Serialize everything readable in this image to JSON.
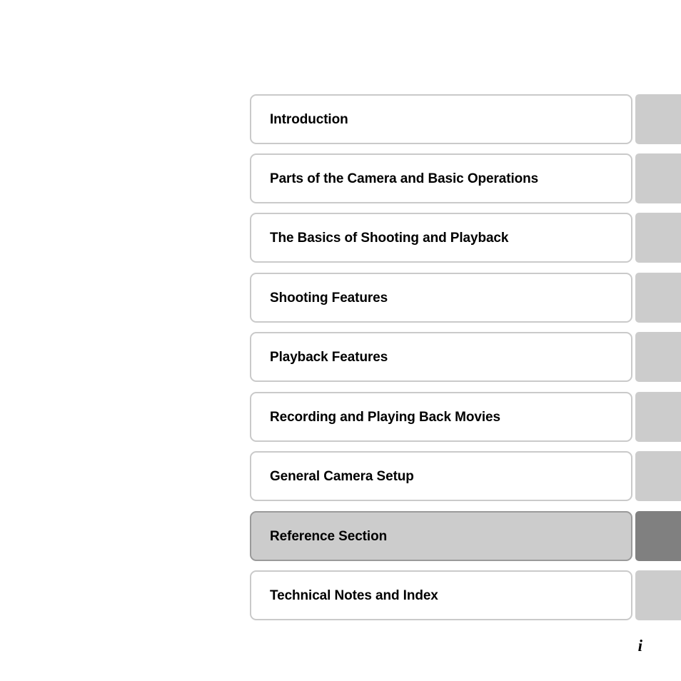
{
  "page": {
    "kind": "camera-manual-section-index",
    "background_color": "#ffffff",
    "page_number": "i"
  },
  "theme": {
    "plate_fill": "#ffffff",
    "plate_border": "#cacaca",
    "tab_fill": "#cccccc",
    "current_plate_fill": "#cccccc",
    "current_plate_border": "#9a9a9a",
    "current_tab_fill": "#808080",
    "text_color": "#000000"
  },
  "section_index": {
    "current_section": "Reference Section",
    "items": [
      {
        "label": "Introduction",
        "current": false
      },
      {
        "label": "Parts of the Camera and Basic Operations",
        "current": false
      },
      {
        "label": "The Basics of Shooting and Playback",
        "current": false
      },
      {
        "label": "Shooting Features",
        "current": false
      },
      {
        "label": "Playback Features",
        "current": false
      },
      {
        "label": "Recording and Playing Back Movies",
        "current": false
      },
      {
        "label": "General Camera Setup",
        "current": false
      },
      {
        "label": "Reference Section",
        "current": true
      },
      {
        "label": "Technical Notes and Index",
        "current": false
      }
    ]
  }
}
